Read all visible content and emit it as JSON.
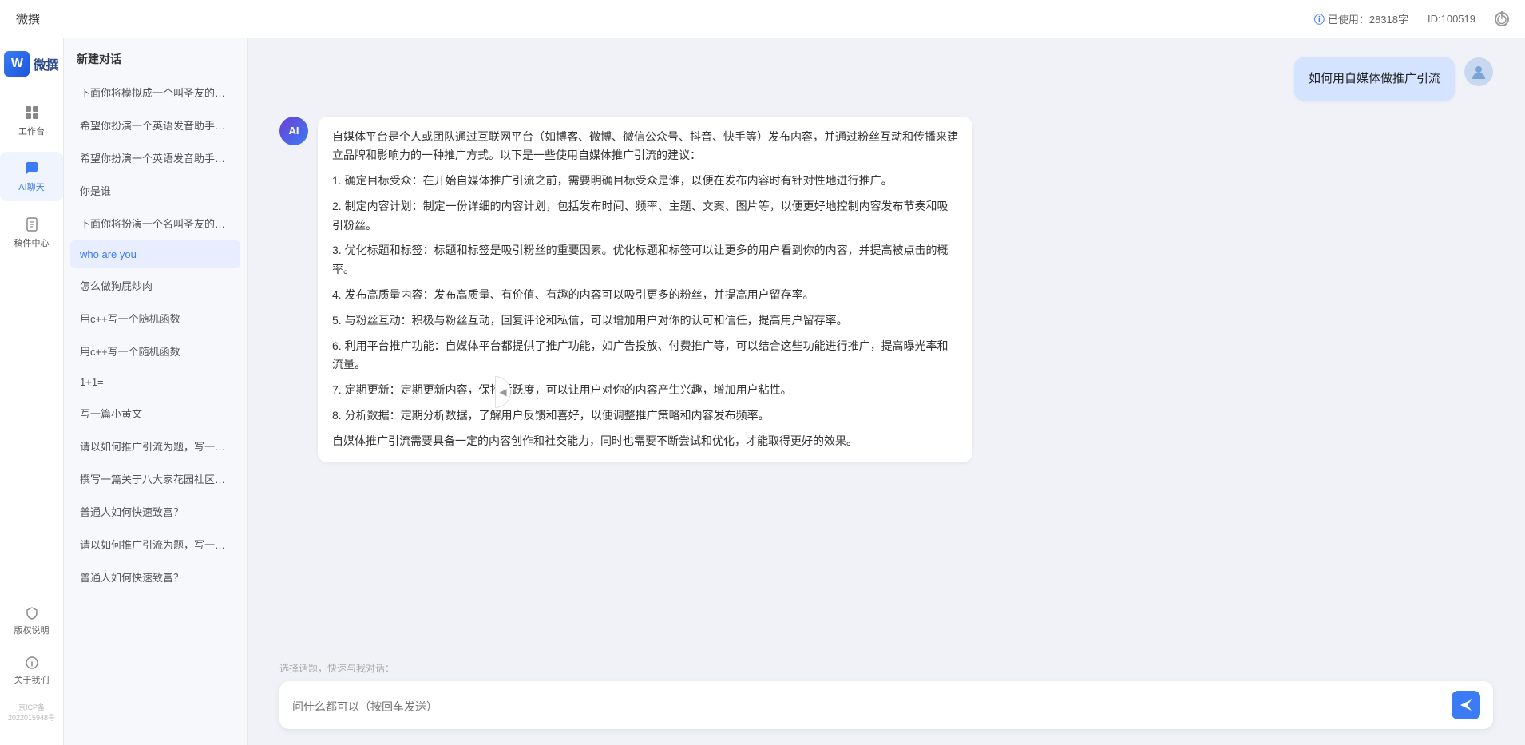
{
  "topbar": {
    "title": "微撰",
    "usage_label": "已使用：28318字",
    "id_label": "ID:100519",
    "usage_icon": "info-icon"
  },
  "left_nav": {
    "logo_letter": "W",
    "logo_text": "微撰",
    "items": [
      {
        "id": "workbench",
        "label": "工作台",
        "icon": "grid-icon"
      },
      {
        "id": "ai-chat",
        "label": "AI聊天",
        "icon": "chat-icon",
        "active": true
      },
      {
        "id": "drafts",
        "label": "稿件中心",
        "icon": "doc-icon"
      }
    ],
    "bottom_items": [
      {
        "id": "copyright",
        "label": "版权说明",
        "icon": "shield-icon"
      },
      {
        "id": "about",
        "label": "关于我们",
        "icon": "info-circle-icon"
      }
    ],
    "icp": "京ICP备2022015948号"
  },
  "conv_list": {
    "header": "新建对话",
    "items": [
      {
        "id": 1,
        "text": "下面你将模拟成一个叫圣友的程序员，我说...",
        "active": false
      },
      {
        "id": 2,
        "text": "希望你扮演一个英语发音助手，我提供给你...",
        "active": false
      },
      {
        "id": 3,
        "text": "希望你扮演一个英语发音助手，我提供给你...",
        "active": false
      },
      {
        "id": 4,
        "text": "你是谁",
        "active": false
      },
      {
        "id": 5,
        "text": "下面你将扮演一个名叫圣友的医生",
        "active": false
      },
      {
        "id": 6,
        "text": "who are you",
        "active": true
      },
      {
        "id": 7,
        "text": "怎么做狗屁炒肉",
        "active": false
      },
      {
        "id": 8,
        "text": "用c++写一个随机函数",
        "active": false
      },
      {
        "id": 9,
        "text": "用c++写一个随机函数",
        "active": false
      },
      {
        "id": 10,
        "text": "1+1=",
        "active": false
      },
      {
        "id": 11,
        "text": "写一篇小黄文",
        "active": false
      },
      {
        "id": 12,
        "text": "请以如何推广引流为题，写一篇大纲",
        "active": false
      },
      {
        "id": 13,
        "text": "撰写一篇关于八大家花园社区一刻钟便民生...",
        "active": false
      },
      {
        "id": 14,
        "text": "普通人如何快速致富？",
        "active": false
      },
      {
        "id": 15,
        "text": "请以如何推广引流为题，写一篇大纲",
        "active": false
      },
      {
        "id": 16,
        "text": "普通人如何快速致富？",
        "active": false
      }
    ]
  },
  "chat": {
    "messages": [
      {
        "id": "user-1",
        "type": "user",
        "text": "如何用自媒体做推广引流"
      },
      {
        "id": "ai-1",
        "type": "ai",
        "paragraphs": [
          "自媒体平台是个人或团队通过互联网平台（如博客、微博、微信公众号、抖音、快手等）发布内容，并通过粉丝互动和传播来建立品牌和影响力的一种推广方式。以下是一些使用自媒体推广引流的建议：",
          "1. 确定目标受众：在开始自媒体推广引流之前，需要明确目标受众是谁，以便在发布内容时有针对性地进行推广。",
          "2. 制定内容计划：制定一份详细的内容计划，包括发布时间、频率、主题、文案、图片等，以便更好地控制内容发布节奏和吸引粉丝。",
          "3. 优化标题和标签：标题和标签是吸引粉丝的重要因素。优化标题和标签可以让更多的用户看到你的内容，并提高被点击的概率。",
          "4. 发布高质量内容：发布高质量、有价值、有趣的内容可以吸引更多的粉丝，并提高用户留存率。",
          "5. 与粉丝互动：积极与粉丝互动，回复评论和私信，可以增加用户对你的认可和信任，提高用户留存率。",
          "6. 利用平台推广功能：自媒体平台都提供了推广功能，如广告投放、付费推广等，可以结合这些功能进行推广，提高曝光率和流量。",
          "7. 定期更新：定期更新内容，保持活跃度，可以让用户对你的内容产生兴趣，增加用户粘性。",
          "8. 分析数据：定期分析数据，了解用户反馈和喜好，以便调整推广策略和内容发布频率。",
          "自媒体推广引流需要具备一定的内容创作和社交能力，同时也需要不断尝试和优化，才能取得更好的效果。"
        ]
      }
    ],
    "quick_topic_placeholder": "选择话题，快速与我对话：",
    "input_placeholder": "问什么都可以（按回车发送）",
    "send_icon": "send-icon"
  }
}
